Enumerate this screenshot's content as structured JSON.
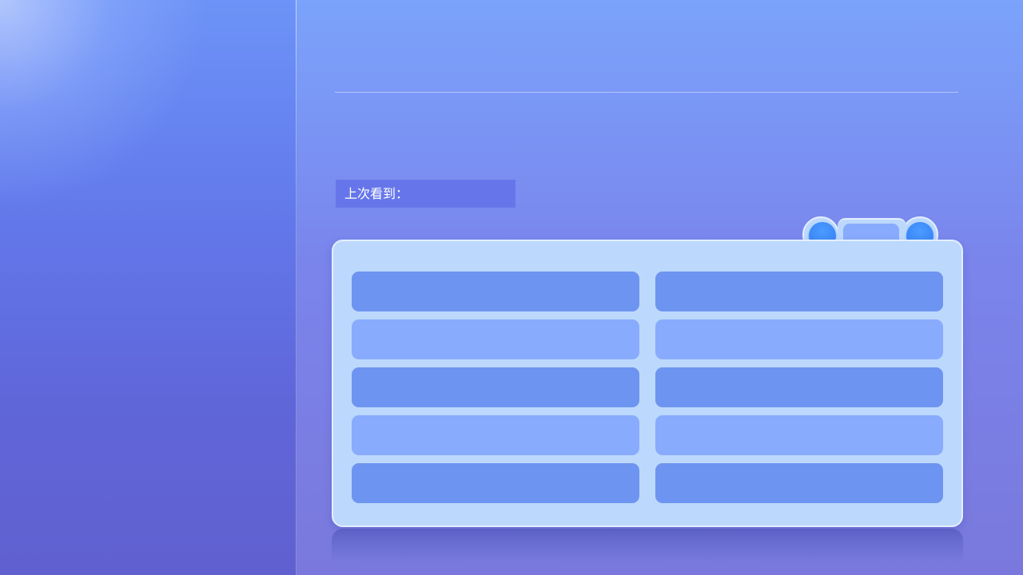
{
  "history": {
    "last_viewed_label": "上次看到："
  },
  "colors": {
    "panel_bg": "#bcd8fd",
    "item_dark": "#6d94f0",
    "item_light": "#89abfd",
    "dot_blue": "#3a86f7",
    "label_bg": "#6676ea"
  },
  "icons": {
    "prev": "circle-dot",
    "next": "circle-dot"
  }
}
